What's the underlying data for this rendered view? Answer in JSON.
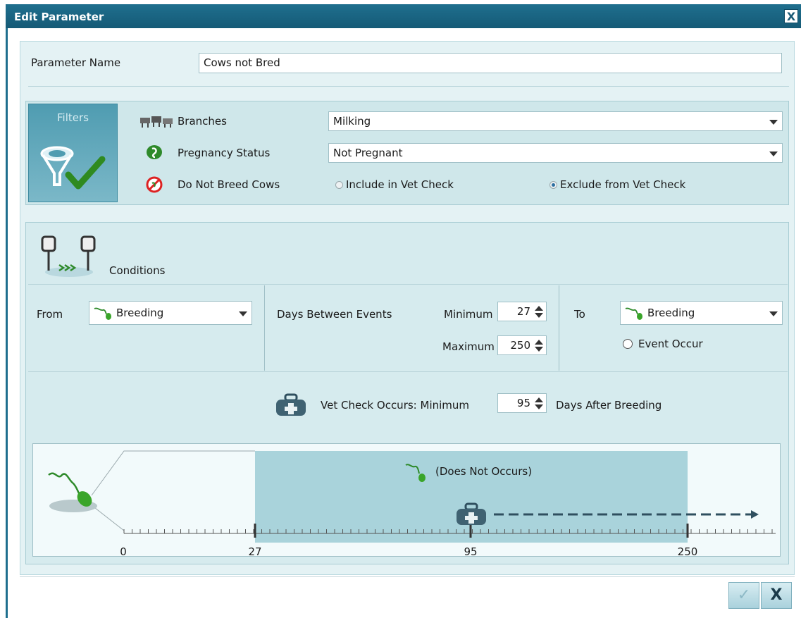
{
  "window": {
    "title": "Edit Parameter",
    "close_label": "X"
  },
  "parameter": {
    "label": "Parameter Name",
    "value": "Cows not Bred"
  },
  "filters": {
    "tile_label": "Filters",
    "branches": {
      "label": "Branches",
      "value": "Milking"
    },
    "pregnancy": {
      "label": "Pregnancy Status",
      "value": "Not Pregnant"
    },
    "do_not_breed": {
      "label": "Do Not Breed Cows",
      "options": [
        "Include in Vet Check",
        "Exclude from Vet Check"
      ],
      "selected": "Exclude from Vet Check"
    }
  },
  "conditions": {
    "label": "Conditions",
    "from_label": "From",
    "from_value": "Breeding",
    "days_between_label": "Days Between Events",
    "minimum_label": "Minimum",
    "minimum_value": "27",
    "maximum_label": "Maximum",
    "maximum_value": "250",
    "to_label": "To",
    "to_value": "Breeding",
    "event_occur_label": "Event Occur",
    "vet_check_label": "Vet Check Occurs: Minimum",
    "vet_check_value": "95",
    "vet_check_suffix": "Days After Breeding"
  },
  "timeline": {
    "note": "(Does Not Occurs)",
    "ticks": [
      "0",
      "27",
      "95",
      "250"
    ]
  },
  "buttons": {
    "ok": "✓",
    "cancel": "X"
  },
  "colors": {
    "title_bar": "#1f6f8e",
    "panel": "#d6ebee",
    "shade": "#a9d3db",
    "accent_green": "#3a9a2a"
  }
}
